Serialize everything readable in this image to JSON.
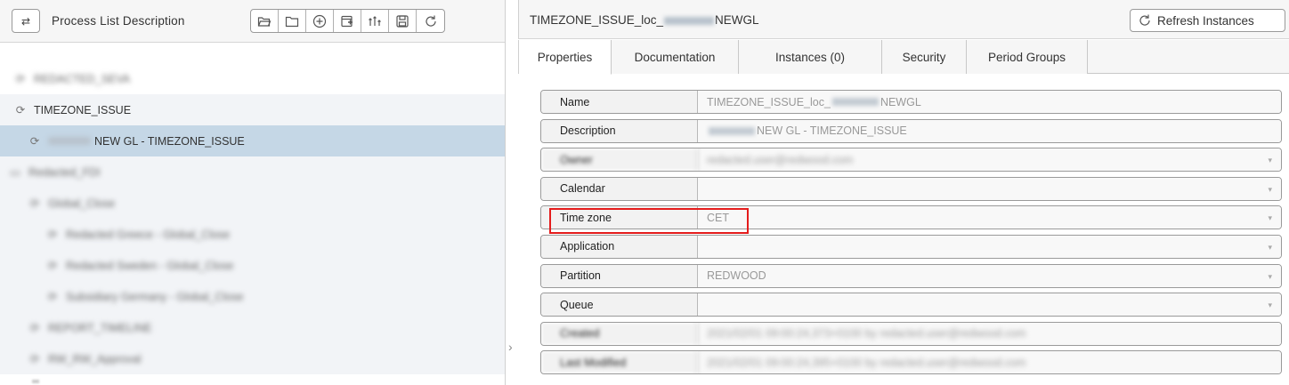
{
  "left": {
    "title": "Process List Description",
    "toggle_icon": "swap-arrows-icon",
    "toolbar": [
      {
        "icon": "folder-open-icon"
      },
      {
        "icon": "folder-icon"
      },
      {
        "icon": "add-circle-icon"
      },
      {
        "icon": "new-definition-icon"
      },
      {
        "icon": "sort-icon"
      },
      {
        "icon": "save-icon"
      },
      {
        "icon": "refresh-icon"
      }
    ],
    "tree": [
      {
        "text": "REDACTED_SEVA",
        "blurred": true,
        "indent": 0
      },
      {
        "text": "TIMEZONE_ISSUE",
        "blurred": false,
        "indent": 0
      },
      {
        "text": " NEW GL - TIMEZONE_ISSUE",
        "blurred": false,
        "indent": 1,
        "selected": true,
        "prefix_masked": true
      },
      {
        "text": "Redacted_FDI",
        "blurred": true,
        "indent": 0
      },
      {
        "text": "Global_Close",
        "blurred": true,
        "indent": 1
      },
      {
        "text": "Redacted Greece - Global_Close",
        "blurred": true,
        "indent": 2
      },
      {
        "text": "Redacted Sweden - Global_Close",
        "blurred": true,
        "indent": 2
      },
      {
        "text": "Subsidiary Germany - Global_Close",
        "blurred": true,
        "indent": 2
      },
      {
        "text": "REPORT_TIMELINE",
        "blurred": true,
        "indent": 1
      },
      {
        "text": "RW_RW_Approval",
        "blurred": true,
        "indent": 1
      }
    ]
  },
  "right": {
    "title_prefix": "TIMEZONE_ISSUE_loc_",
    "title_suffix": "NEWGL",
    "refresh_label": "Refresh Instances",
    "tabs": [
      "Properties",
      "Documentation",
      "Instances (0)",
      "Security",
      "Period Groups"
    ],
    "properties": [
      {
        "label": "Name",
        "value_prefix": "TIMEZONE_ISSUE_loc_",
        "value_suffix": "NEWGL",
        "masked": true,
        "dropdown": false
      },
      {
        "label": "Description",
        "value_prefix": "",
        "value_suffix": " NEW GL - TIMEZONE_ISSUE",
        "masked": true,
        "dropdown": false
      },
      {
        "label": "Owner",
        "value": "redacted.user@redwood.com",
        "blurred": true,
        "dropdown": true
      },
      {
        "label": "Calendar",
        "value": "",
        "dropdown": true
      },
      {
        "label": "Time zone",
        "value": "CET",
        "dropdown": true,
        "highlighted": true
      },
      {
        "label": "Application",
        "value": "",
        "dropdown": true
      },
      {
        "label": "Partition",
        "value": "REDWOOD",
        "dropdown": true
      },
      {
        "label": "Queue",
        "value": "",
        "dropdown": true
      },
      {
        "label": "Created",
        "value": "2021/02/01 09:00:24,373+0100 by redacted.user@redwood.com",
        "blurred": true,
        "dropdown": false
      },
      {
        "label": "Last Modified",
        "value": "2021/02/01 09:00:24,395+0100 by redacted.user@redwood.com",
        "blurred": true,
        "dropdown": false
      }
    ]
  },
  "colors": {
    "selected_row": "#c5d7e6",
    "highlight_border": "#e41c1c",
    "header_bg": "#f6f6f6"
  }
}
